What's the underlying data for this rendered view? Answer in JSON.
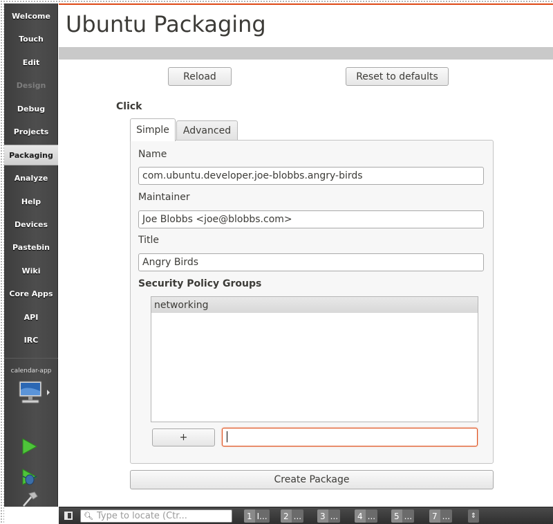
{
  "sidebar": {
    "items": [
      {
        "label": "Welcome",
        "state": "normal"
      },
      {
        "label": "Touch",
        "state": "normal"
      },
      {
        "label": "Edit",
        "state": "normal"
      },
      {
        "label": "Design",
        "state": "disabled"
      },
      {
        "label": "Debug",
        "state": "normal"
      },
      {
        "label": "Projects",
        "state": "normal"
      },
      {
        "label": "Packaging",
        "state": "active"
      },
      {
        "label": "Analyze",
        "state": "normal"
      },
      {
        "label": "Help",
        "state": "normal"
      },
      {
        "label": "Devices",
        "state": "normal"
      },
      {
        "label": "Pastebin",
        "state": "normal"
      },
      {
        "label": "Wiki",
        "state": "normal"
      },
      {
        "label": "Core Apps",
        "state": "normal"
      },
      {
        "label": "API",
        "state": "normal"
      },
      {
        "label": "IRC",
        "state": "normal"
      }
    ],
    "kit_label": "calendar-app",
    "icons": {
      "kit": "monitor-icon",
      "run": "play-icon",
      "debug": "debug-run-icon",
      "build": "hammer-icon"
    }
  },
  "header": {
    "title": "Ubuntu Packaging",
    "accent_color": "#dd4814"
  },
  "toolbar": {
    "reload_label": "Reload",
    "reset_label": "Reset to defaults"
  },
  "click_section": {
    "label": "Click",
    "tabs": [
      {
        "label": "Simple",
        "active": true
      },
      {
        "label": "Advanced",
        "active": false
      }
    ],
    "fields": {
      "name_label": "Name",
      "name_value": "com.ubuntu.developer.joe-blobbs.angry-birds",
      "maintainer_label": "Maintainer",
      "maintainer_value": "Joe Blobbs <joe@blobbs.com>",
      "title_label": "Title",
      "title_value": "Angry Birds"
    },
    "security": {
      "label": "Security Policy Groups",
      "items": [
        "networking"
      ],
      "add_label": "+",
      "new_group_value": ""
    },
    "create_label": "Create Package"
  },
  "statusbar": {
    "locator_placeholder": "Type to locate (Ctr...",
    "output_tabs": [
      {
        "num": "1",
        "label": "I..."
      },
      {
        "num": "2",
        "label": "..."
      },
      {
        "num": "3",
        "label": "..."
      },
      {
        "num": "4",
        "label": "..."
      },
      {
        "num": "5",
        "label": "..."
      },
      {
        "num": "7",
        "label": "..."
      }
    ],
    "arrows": "⇕"
  }
}
